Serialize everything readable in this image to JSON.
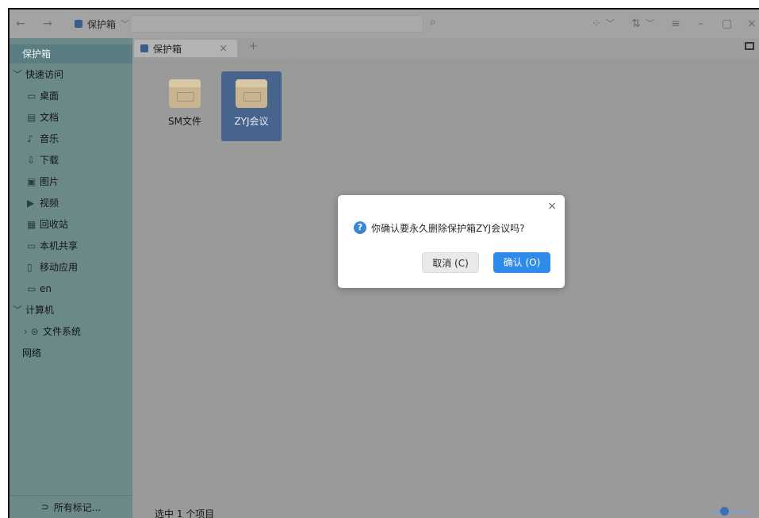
{
  "titlebar": {
    "back_glyph": "←",
    "forward_glyph": "→",
    "location_label": "保护箱",
    "location_chevron": "﹀",
    "view_icons_glyph": "⁘",
    "view_chevron": "﹀",
    "sort_glyph": "⇅",
    "sort_chevron": "﹀",
    "menu_glyph": "≡",
    "minimize_glyph": "–",
    "maximize_glyph": "▢",
    "close_glyph": "×"
  },
  "sidebar": {
    "items": [
      {
        "label": "保护箱",
        "icon": "",
        "selected": true
      },
      {
        "label": "快速访问",
        "icon": "﹀"
      },
      {
        "label": "桌面",
        "icon": "▭"
      },
      {
        "label": "文档",
        "icon": "▤"
      },
      {
        "label": "音乐",
        "icon": "♪"
      },
      {
        "label": "下载",
        "icon": "⇩"
      },
      {
        "label": "图片",
        "icon": "▣"
      },
      {
        "label": "视频",
        "icon": "▶"
      },
      {
        "label": "回收站",
        "icon": "▦"
      },
      {
        "label": "本机共享",
        "icon": "▭"
      },
      {
        "label": "移动应用",
        "icon": "▯"
      },
      {
        "label": "en",
        "icon": "▭"
      },
      {
        "label": "计算机",
        "icon": "﹀"
      },
      {
        "label": "文件系统",
        "icon": "› ⊜"
      },
      {
        "label": "网络",
        "icon": ""
      }
    ],
    "bottom_label": "所有标记...",
    "bottom_icon": "⊃"
  },
  "tabs": {
    "active_label": "保护箱",
    "close_glyph": "×",
    "add_glyph": "+"
  },
  "files": [
    {
      "name": "SM文件",
      "selected": false
    },
    {
      "name": "ZYJ会议",
      "selected": true
    }
  ],
  "status": {
    "text": "选中 1 个项目",
    "zoom_level": 0.33
  },
  "dialog": {
    "message": "你确认要永久删除保护箱ZYJ会议吗?",
    "cancel_label": "取消 (C)",
    "confirm_label": "确认 (O)",
    "close_glyph": "×",
    "question_glyph": "?"
  },
  "colors": {
    "sidebar_bg": "#6b8989",
    "selected_file_bg": "#47648c",
    "primary_button": "#2f8bea",
    "dim_overlay": "#9a9a9a"
  }
}
